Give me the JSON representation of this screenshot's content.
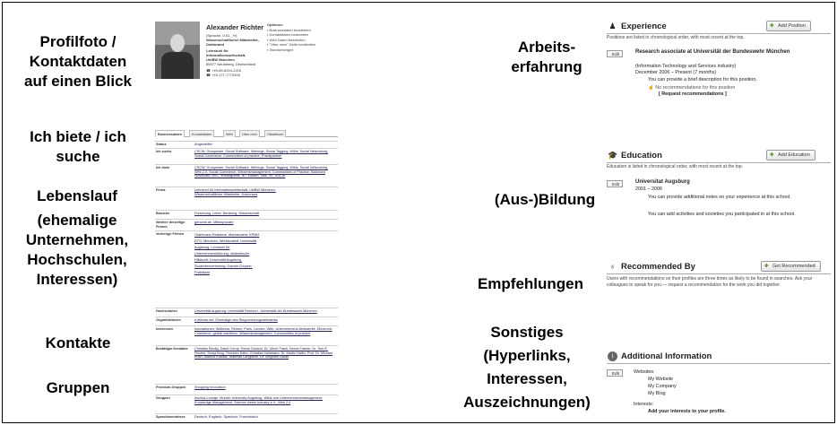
{
  "labels": {
    "profile": [
      "Profilfoto /",
      "Kontaktdaten",
      "auf einen Blick"
    ],
    "offer": [
      "Ich biete / ich",
      "suche"
    ],
    "cv": [
      "Lebenslauf",
      "(ehemalige",
      "Unternehmen,",
      "Hochschulen,",
      "Interessen)"
    ],
    "contacts": "Kontakte",
    "groups": "Gruppen",
    "work": [
      "Arbeits-",
      "erfahrung"
    ],
    "education": "(Aus-)Bildung",
    "recommendations": "Empfehlungen",
    "misc": [
      "Sonstiges",
      "(Hyperlinks,",
      "Interessen,",
      "Auszeichnungen)"
    ]
  },
  "xing": {
    "name": "Alexander Richter",
    "info": [
      "(Sprache, 0,51,_%)",
      "Wissenschaftlicher Mitarbeiter,",
      "Doktorand",
      "Lehrstuhl für Informationswirtschaft,",
      "UniBW München",
      "85577 Neubiberg, Deutschland",
      "☎ +49-89-6004-2216",
      "☎ +49-177-7772926"
    ],
    "options_title": "Optionen",
    "options": [
      "Businessdaten bearbeiten",
      "Kontaktdaten bearbeiten",
      "Web-Daten bearbeiten",
      "\"Über mich\"-Seite bearbeiten",
      "Standortzeigen"
    ],
    "tabs": [
      "Businessdaten",
      "Kontaktdaten",
      "Web",
      "Über mich",
      "Gästebuch"
    ],
    "rows": [
      {
        "key": "Status",
        "value": "Angestellter"
      },
      {
        "key": "Ich suche",
        "value": "CSCW, Groupware, Social Software, Weblogs, Social Tagging, Wikis, Social Networking, Social Commerce, Communities of practice, Praxispartner"
      },
      {
        "key": "Ich biete",
        "value": "CSCW, Groupware, Social Software, Weblogs, Social Tagging, Wikis, Social Networking, Web 2.0, Social Commerce, Wissensmanagement, Communities of Practice, Balanced Scorecard, BSC, eHistograms, IKT Kosten, Vitis, VE, BSCW"
      },
      {
        "key": "Firma",
        "value": "Lehrstuhl für Informationswirtschaft, UniBW München, Wissenschaftlicher Mitarbeiter, Doktorand"
      },
      {
        "key": "Branche",
        "value": "Forschung, Lehre, Beratung, Wissenschaft"
      },
      {
        "key": "Weitere derzeitige Firmen",
        "value": "genome.de, Mitbegründer"
      },
      {
        "key": "Vorherige Firmen",
        "value": "Ostermann Relations, Werkstudent; KPMG DTG, München, Werkstudent; Universität Augsburg, Lehrstuhl für Unternehmensführung, studentische Hilfskraft; Universität Augsburg, Studentenvertretung; DaimlerChrysler, Praktikant"
      },
      {
        "key": "Hochschulen",
        "value": "Universität Augsburg, Universität Rennes I, Universität der Bundeswehr München"
      },
      {
        "key": "Organisationen",
        "value": "e-fellows.net, Ehemalige des Ringvorlesungsnetzwerks"
      },
      {
        "key": "Interessen",
        "value": "Innovationen, Wellness, Reisen, Paris, London, Web, Unternehmens-Netzwerke, Electronic Commerce, global marathon, Wissensmanagement, Communities of practice"
      },
      {
        "key": "Bestätigte Kontakte",
        "value": "Christian Bludig, David Cerny, Simon Durand, Dr. Ulrich Frank, Bernd Franke, Dr. Tom E. Fischer, Sonja Klug, Thorsten Kahn, Christian Hartmann, Dr. Martin Haller, Prof. Dr. Michael Koch, Markus Kowatz, Matthias Langheim, Dr. Siegfried Lukas"
      },
      {
        "key": "Premium-Gruppen",
        "value": "Shopping Innovation"
      },
      {
        "key": "Gruppen",
        "value": "Access-Lounge, Munich University Augsburg, Wikis und Unternehmensmanagement, Knowledge Management, Science meets Industry e.V., Web 2.0"
      },
      {
        "key": "Sprachkenntnisse",
        "value": "Deutsch, Englisch, Spanisch, Französisch"
      }
    ]
  },
  "experience": {
    "title": "Experience",
    "button": "Add Position",
    "note": "Positions are listed in chronological order, with most recent at the top.",
    "edit": "Edit",
    "position_title": "Research associate at Universität der Bundeswehr München",
    "industry": "(Information Technology and Services industry)",
    "dates": "December 2006 – Present (7 months)",
    "desc": "You can provide a brief description for this position.",
    "no_recs": "No recommendations for this position",
    "request": "[ Request recommendations ]"
  },
  "education": {
    "title": "Education",
    "button": "Add Education",
    "note": "Education is listed in chronological order, with most recent at the top.",
    "edit": "Edit",
    "school": "Universitat Augsburg",
    "years": "2001 – 2006",
    "line1": "You can provide additional notes on your experience at this school.",
    "line2": "You can add activities and societies you participated in at this school."
  },
  "recommended": {
    "title": "Recommended By",
    "button": "Get Recommended",
    "text": "Users with recommendations on their profiles are three times as likely to be found in searches. Ask your colleagues to speak for you — request a recommendation for the work you did together."
  },
  "additional": {
    "title": "Additional Information",
    "edit": "Edit",
    "websites_label": "Websites:",
    "websites": [
      "My Website",
      "My Company",
      "My Blog"
    ],
    "interests_label": "Interests:",
    "interests_text": "Add your interests to your profile."
  }
}
